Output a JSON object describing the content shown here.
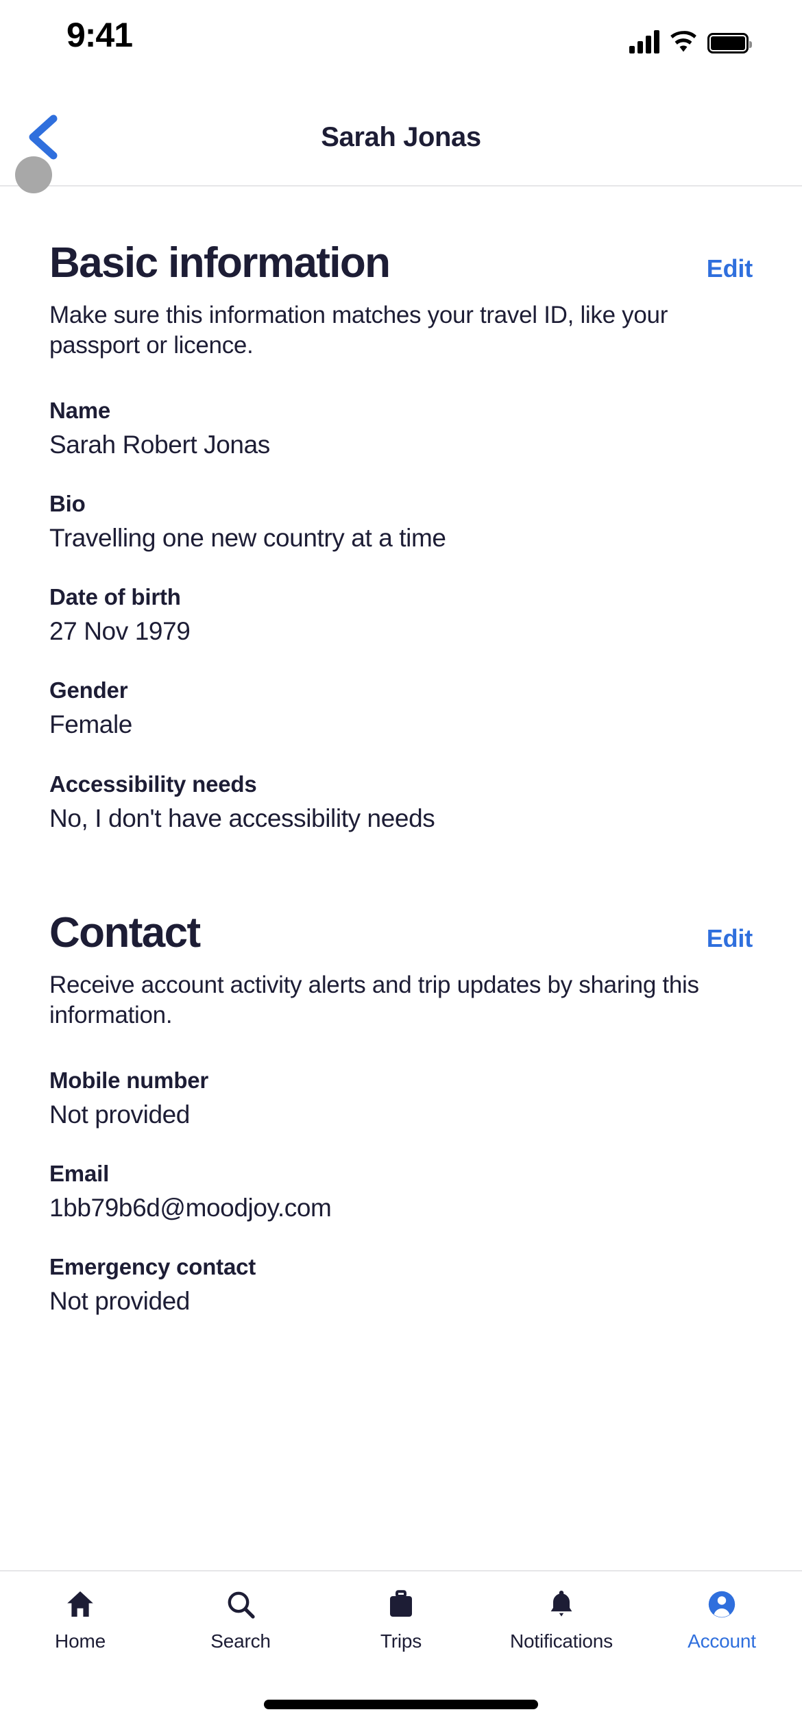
{
  "status_bar": {
    "time": "9:41",
    "cellular_icon": "signal-bars-icon",
    "wifi_icon": "wifi-icon",
    "battery_icon": "battery-full-icon"
  },
  "nav": {
    "back_icon": "chevron-left-icon",
    "title": "Sarah Jonas"
  },
  "colors": {
    "accent_blue": "#2f6fdd",
    "text_dark": "#1d1d35",
    "divider": "#e6e6e8",
    "cursor": "#a8a8a8"
  },
  "sections": [
    {
      "title": "Basic information",
      "edit_label": "Edit",
      "description": "Make sure this information matches your travel ID, like your passport or licence.",
      "fields": [
        {
          "label": "Name",
          "value": "Sarah Robert Jonas"
        },
        {
          "label": "Bio",
          "value": "Travelling one new country at a time"
        },
        {
          "label": "Date of birth",
          "value": "27 Nov 1979"
        },
        {
          "label": "Gender",
          "value": "Female"
        },
        {
          "label": "Accessibility needs",
          "value": "No, I don't have accessibility needs"
        }
      ]
    },
    {
      "title": "Contact",
      "edit_label": "Edit",
      "description": "Receive account activity alerts and trip updates by sharing this information.",
      "fields": [
        {
          "label": "Mobile number",
          "value": "Not provided"
        },
        {
          "label": "Email",
          "value": "1bb79b6d@moodjoy.com"
        },
        {
          "label": "Emergency contact",
          "value": "Not provided"
        }
      ]
    }
  ],
  "tab_bar": {
    "items": [
      {
        "label": "Home",
        "icon": "home-icon",
        "active": false
      },
      {
        "label": "Search",
        "icon": "search-icon",
        "active": false
      },
      {
        "label": "Trips",
        "icon": "suitcase-icon",
        "active": false
      },
      {
        "label": "Notifications",
        "icon": "bell-icon",
        "active": false
      },
      {
        "label": "Account",
        "icon": "account-person-icon",
        "active": true
      }
    ]
  }
}
